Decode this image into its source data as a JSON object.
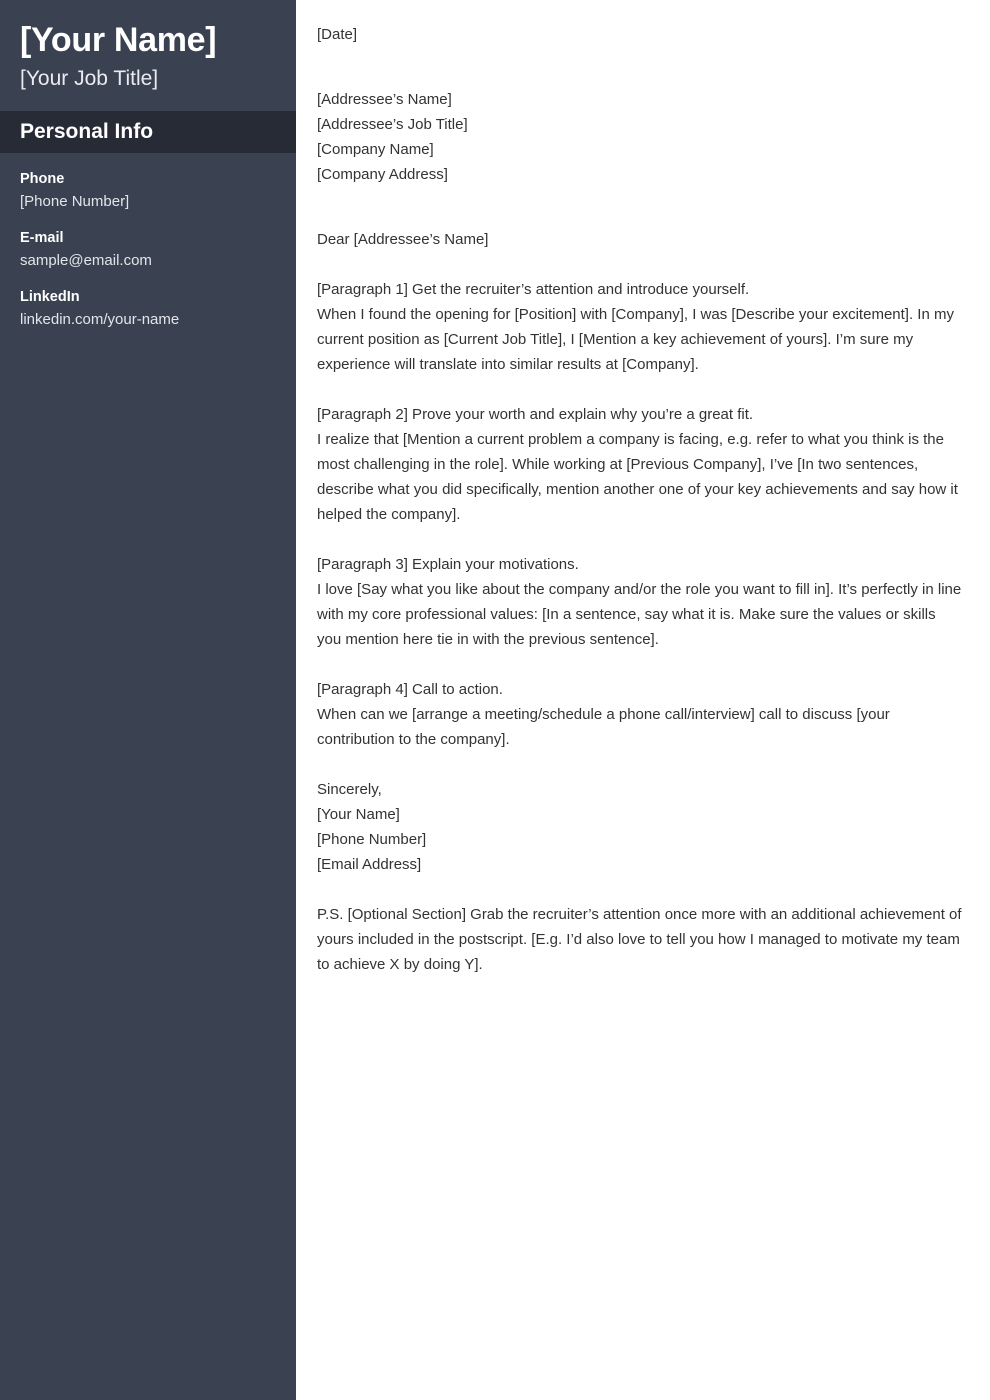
{
  "sidebar": {
    "name": "[Your Name]",
    "job_title": "[Your Job Title]",
    "section_title": "Personal Info",
    "info_items": [
      {
        "label": "Phone",
        "value": "[Phone Number]"
      },
      {
        "label": "E-mail",
        "value": "sample@email.com"
      },
      {
        "label": "LinkedIn",
        "value": "linkedin.com/your-name"
      }
    ]
  },
  "letter": {
    "date": "[Date]",
    "addressee": [
      "[Addressee’s Name]",
      "[Addressee’s Job Title]",
      "[Company Name]",
      "[Company Address]"
    ],
    "greeting": "Dear [Addressee’s Name]",
    "paragraphs": [
      {
        "heading": "[Paragraph 1] Get the recruiter’s attention and introduce yourself.",
        "body": "When I found the opening for [Position] with [Company], I was [Describe your excitement]. In my current position as [Current Job Title], I [Mention a key achievement of yours]. I’m sure my experience will translate into similar results at [Company]."
      },
      {
        "heading": "[Paragraph 2] Prove your worth and explain why you’re a great fit.",
        "body": "I realize that [Mention a current problem a company is facing, e.g. refer to what you think is the most challenging in the role]. While working at [Previous Company], I’ve [In two sentences, describe what you did specifically, mention another one of your key achievements and say how it helped the company]."
      },
      {
        "heading": "[Paragraph 3] Explain your motivations.",
        "body": "I love [Say what you like about the company and/or the role you want to fill in]. It’s perfectly in line with my core professional values: [In a sentence, say what it is. Make sure the values or skills you mention here tie in with the previous sentence]."
      },
      {
        "heading": "[Paragraph 4] Call to action.",
        "body": "When can we [arrange a meeting/schedule a phone call/interview] call to discuss [your contribution to the company]."
      }
    ],
    "signature": [
      "Sincerely,",
      "[Your Name]",
      "[Phone Number]",
      "[Email Address]"
    ],
    "postscript": "P.S. [Optional Section] Grab the recruiter’s attention once more with an additional achievement of yours included in the postscript. [E.g. I’d also love to tell you how I managed to motivate my team to achieve X by doing Y]."
  },
  "colors": {
    "sidebar_bg": "#3a4150",
    "section_band_bg": "#272b35",
    "sidebar_text": "#ffffff",
    "letter_text": "#333333",
    "page_bg": "#ffffff"
  }
}
